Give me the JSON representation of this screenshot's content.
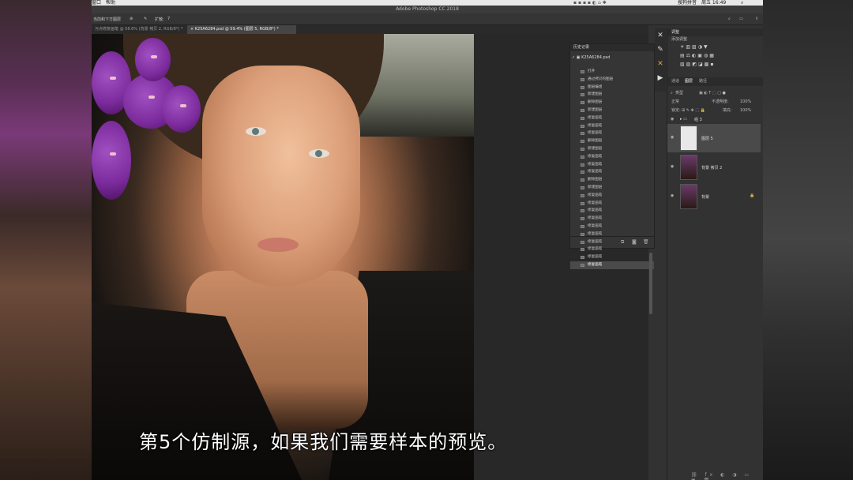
{
  "menu": {
    "window": "窗口",
    "help": "帮助",
    "status_right": "搜狗拼音",
    "clock": "周五 16:49"
  },
  "app_title": "Adobe Photoshop CC 2018",
  "options": {
    "sample": "当前和下方图层",
    "spread_label": "扩散:",
    "spread_value": "7"
  },
  "tabs": [
    {
      "label": "污点修复画笔 @ 58.6% (背景 拷贝 2, RGB/8*) *"
    },
    {
      "label": "K25A6284.psd @ 59.4% (图层 5, RGB/8*) *"
    }
  ],
  "subtitle": "第5个仿制源，如果我们需要样本的预览。",
  "history": {
    "title": "历史记录",
    "snapshot": "K25A6284.psd",
    "items": [
      "打开",
      "通过拷贝的图层",
      "图层编组",
      "新建图层",
      "删除图层",
      "新建图层",
      "修复画笔",
      "修复画笔",
      "修复画笔",
      "删除图层",
      "新建图层",
      "修复画笔",
      "修复画笔",
      "修复画笔",
      "删除图层",
      "新建图层",
      "修复画笔",
      "修复画笔",
      "修复画笔",
      "修复画笔",
      "修复画笔",
      "修复画笔",
      "修复画笔",
      "修复画笔",
      "修复画笔",
      "修复画笔"
    ]
  },
  "adjustments": {
    "title": "调整",
    "subtitle": "添加调整"
  },
  "layers_panel": {
    "tabs": [
      "通道",
      "图层",
      "路径"
    ],
    "kind": "类型",
    "blend": "正常",
    "opacity_label": "不透明度:",
    "opacity": "100%",
    "lock_label": "锁定:",
    "fill_label": "填充:",
    "fill": "100%",
    "group": "组 3",
    "layers": [
      {
        "name": "图层 5"
      },
      {
        "name": "背景 拷贝 2"
      },
      {
        "name": "背景"
      }
    ]
  },
  "colors": {
    "panel": "#323232",
    "selection": "#4a4a4a",
    "subtitle_text": "#ffffff"
  }
}
